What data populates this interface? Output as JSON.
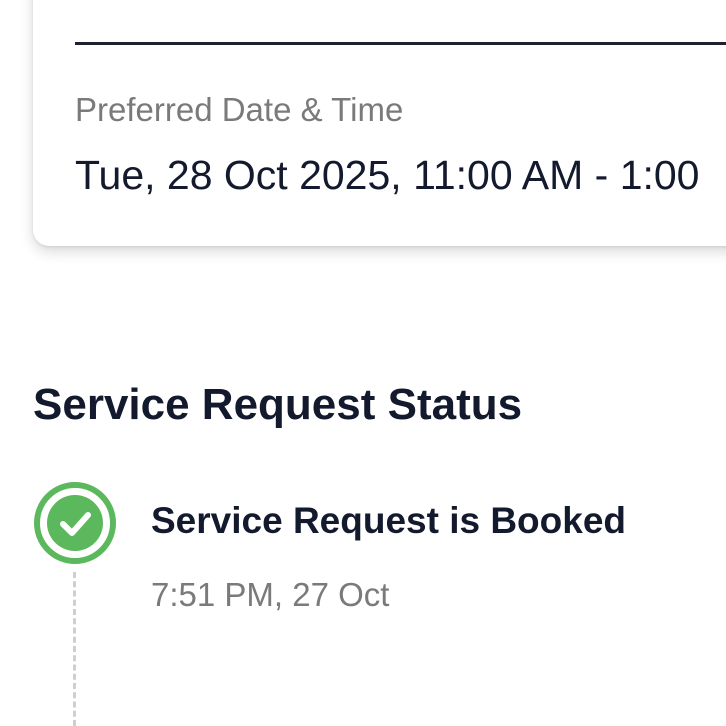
{
  "booking_card": {
    "preferred_label": "Preferred Date & Time",
    "preferred_value": "Tue, 28 Oct 2025, 11:00 AM - 1:00"
  },
  "status": {
    "title": "Service Request Status",
    "events": [
      {
        "title": "Service Request is Booked",
        "time": "7:51 PM, 27 Oct",
        "icon": "check-circle-icon",
        "state": "completed"
      }
    ]
  },
  "colors": {
    "text_primary": "#141a2e",
    "text_secondary": "#7a7a7a",
    "success_green": "#5cb85c",
    "timeline_dash": "#cfcfcf"
  }
}
